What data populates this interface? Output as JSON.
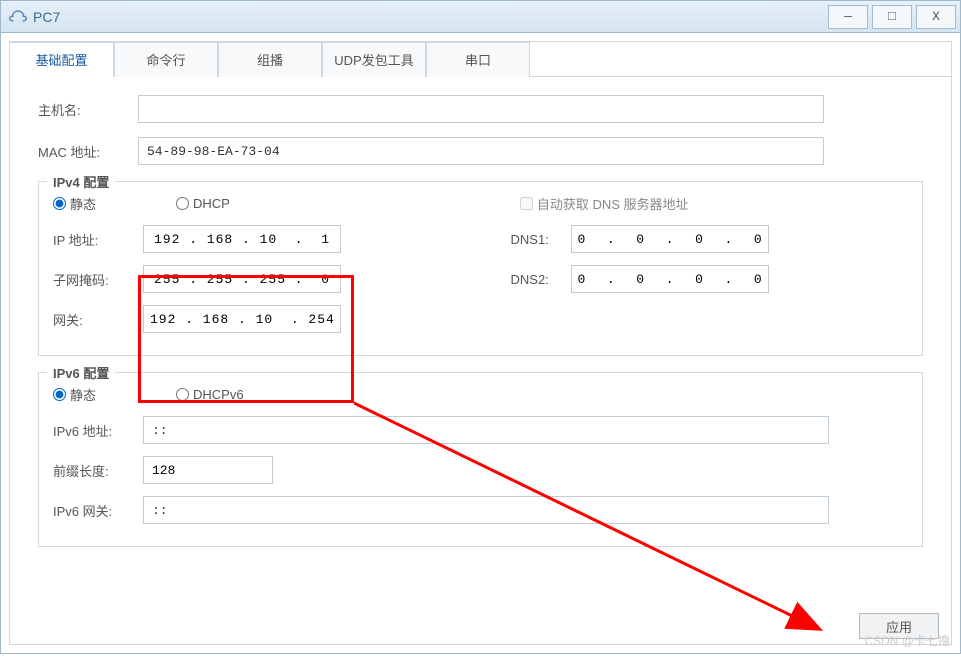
{
  "window": {
    "title": "PC7"
  },
  "tabs": [
    {
      "label": "基础配置",
      "active": true
    },
    {
      "label": "命令行",
      "active": false
    },
    {
      "label": "组播",
      "active": false
    },
    {
      "label": "UDP发包工具",
      "active": false
    },
    {
      "label": "串口",
      "active": false
    }
  ],
  "fields": {
    "hostname_label": "主机名:",
    "hostname_value": "",
    "mac_label": "MAC 地址:",
    "mac_value": "54-89-98-EA-73-04"
  },
  "ipv4": {
    "legend": "IPv4 配置",
    "static_label": "静态",
    "dhcp_label": "DHCP",
    "auto_dns_label": "自动获取 DNS 服务器地址",
    "ip_label": "IP 地址:",
    "ip_value": "192 . 168 . 10  .  1",
    "mask_label": "子网掩码:",
    "mask_value": "255 . 255 . 255 .  0",
    "gw_label": "网关:",
    "gw_value": "192 . 168 . 10  . 254",
    "dns1_label": "DNS1:",
    "dns1_value": "0  .  0  .  0  .  0",
    "dns2_label": "DNS2:",
    "dns2_value": "0  .  0  .  0  .  0"
  },
  "ipv6": {
    "legend": "IPv6 配置",
    "static_label": "静态",
    "dhcp_label": "DHCPv6",
    "addr_label": "IPv6 地址:",
    "addr_value": "::",
    "prefix_label": "前缀长度:",
    "prefix_value": "128",
    "gw_label": "IPv6 网关:",
    "gw_value": "::"
  },
  "buttons": {
    "apply": "应用"
  },
  "watermark": "CSDN @卡七撸"
}
